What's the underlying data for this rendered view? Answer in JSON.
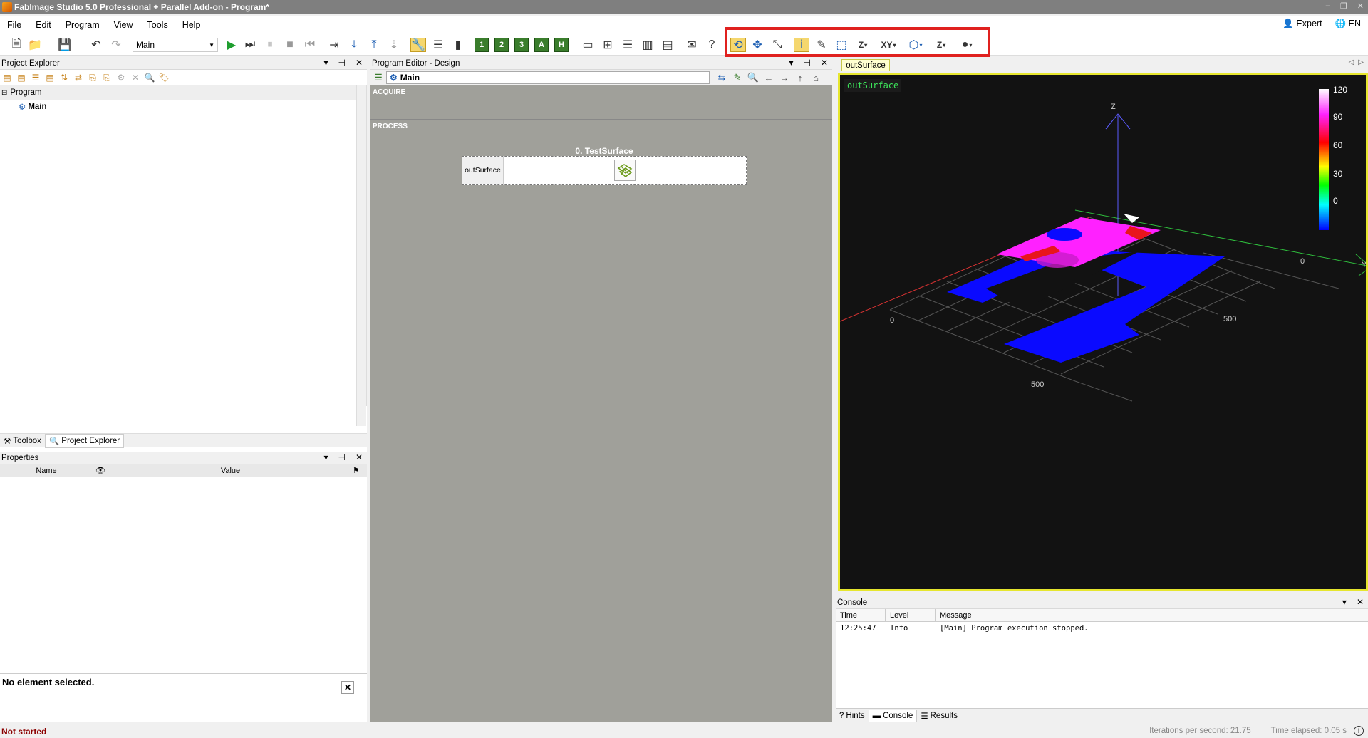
{
  "window": {
    "title": "FabImage Studio 5.0 Professional + Parallel Add-on - Program*",
    "controls": [
      "–",
      "❐",
      "✕"
    ]
  },
  "menu": {
    "items": [
      "File",
      "Edit",
      "Program",
      "View",
      "Tools",
      "Help"
    ],
    "mode": "Expert",
    "language": "EN"
  },
  "toolbar": {
    "program_select": "Main"
  },
  "project_explorer": {
    "title": "Project Explorer",
    "tree_root": "Program",
    "tree_child": "Main",
    "tabs": [
      "Toolbox",
      "Project Explorer"
    ]
  },
  "properties": {
    "title": "Properties",
    "columns": [
      "Name",
      "Value"
    ],
    "empty_message": "No element selected."
  },
  "editor": {
    "title": "Program Editor - Design",
    "macro_select": "Main",
    "sections": [
      "ACQUIRE",
      "PROCESS"
    ],
    "filter_title": "0. TestSurface",
    "filter_port": "outSurface"
  },
  "viewer": {
    "tab": "outSurface",
    "label": "outSurface",
    "axis_z": "Z",
    "axis_y": "Y",
    "ticks": [
      "0",
      "500",
      "500",
      "0"
    ],
    "colorbar": [
      "120",
      "90",
      "60",
      "30",
      "0"
    ]
  },
  "console": {
    "title": "Console",
    "columns": [
      "Time",
      "Level",
      "Message"
    ],
    "rows": [
      {
        "time": "12:25:47",
        "level": "Info",
        "message": "[Main] Program execution stopped."
      }
    ],
    "tabs": [
      "Hints",
      "Console",
      "Results"
    ]
  },
  "status": {
    "state": "Not started",
    "iterations": "Iterations per second: 21.75",
    "elapsed": "Time elapsed: 0.05 s"
  }
}
